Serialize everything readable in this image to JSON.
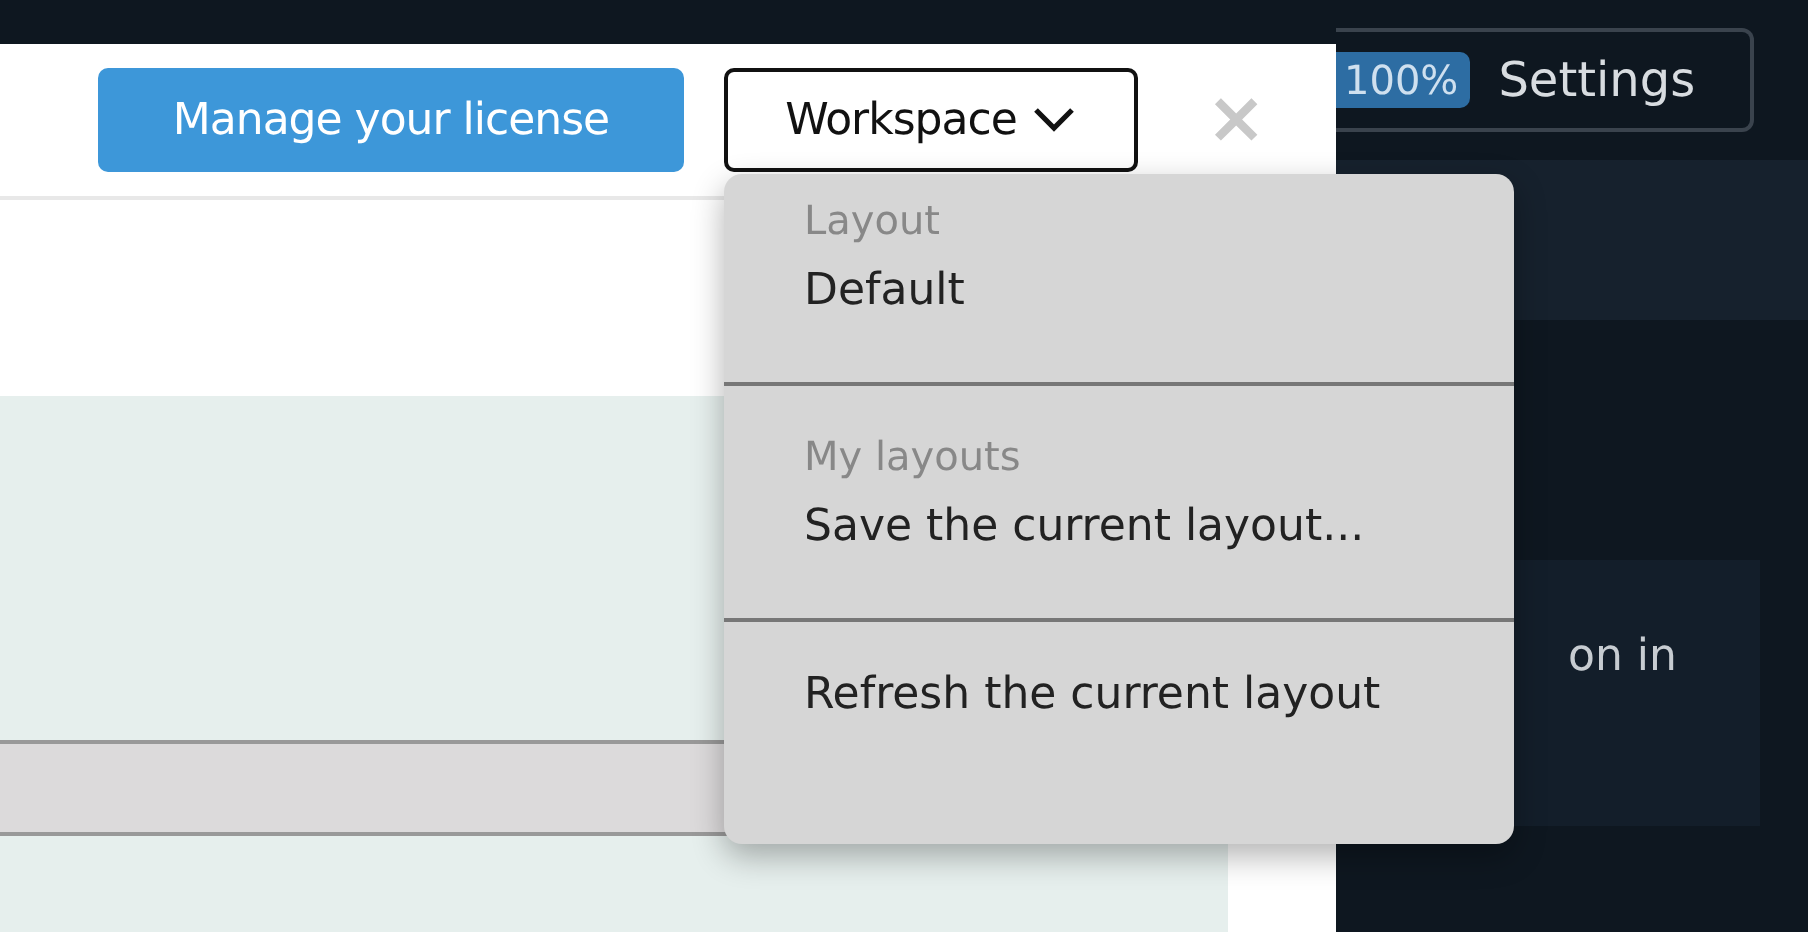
{
  "header": {
    "license_button": "Manage your license",
    "workspace_button": {
      "label": "Workspace",
      "expanded": true
    },
    "close": "×"
  },
  "settings": {
    "zoom": "100%",
    "label": "Settings"
  },
  "side_card": {
    "text": "on in"
  },
  "workspace_menu": {
    "sections": [
      {
        "title": "Layout",
        "items": [
          "Default"
        ]
      },
      {
        "title": "My layouts",
        "items": [
          "Save the current layout..."
        ]
      },
      {
        "items": [
          "Refresh the current layout"
        ]
      }
    ]
  }
}
